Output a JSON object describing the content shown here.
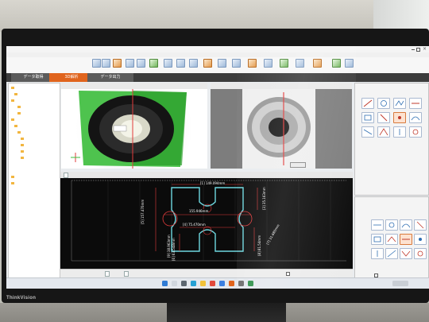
{
  "app": {
    "title": ""
  },
  "tabs": [
    {
      "label": "データ取得"
    },
    {
      "label": "3D解析"
    },
    {
      "label": "データ出力"
    }
  ],
  "tree": {
    "items": []
  },
  "view_headers": {
    "left": "",
    "right": ""
  },
  "left_view": {
    "annotation": ""
  },
  "right_panel_1": {
    "title": "",
    "tabs": []
  },
  "right_panel_2": {
    "title": "",
    "tabs": [],
    "check_label": "",
    "bottom_label": ""
  },
  "chart_toolbar": {
    "button_label": ""
  },
  "measurements": [
    {
      "id": "m1",
      "text": "[1] 149.094mm"
    },
    {
      "id": "m2",
      "text": "155.946mm"
    },
    {
      "id": "m3",
      "text": "[4] 75.470mm"
    },
    {
      "id": "m4",
      "text": "[5] 157.470mm"
    },
    {
      "id": "m5",
      "text": "[3] 35.163mm"
    },
    {
      "id": "m6",
      "text": "[6] 63.548mm"
    },
    {
      "id": "m7",
      "text": "[8] 81.54mm"
    },
    {
      "id": "m8",
      "text": "[7] 31.680mm"
    },
    {
      "id": "m9",
      "text": "[9] 38.963mm"
    }
  ],
  "bottom_bar": {
    "left_button": "",
    "right_button": "",
    "status": ""
  },
  "monitor": {
    "brand": "ThinkVision"
  },
  "colors": {
    "accent": "#e0641d",
    "profile": "#6ed8e0",
    "dimension": "#e23b3b",
    "plot_bg": "#0b0b0b"
  },
  "icons": [
    "folder-icon",
    "tool-icon",
    "close-icon"
  ]
}
